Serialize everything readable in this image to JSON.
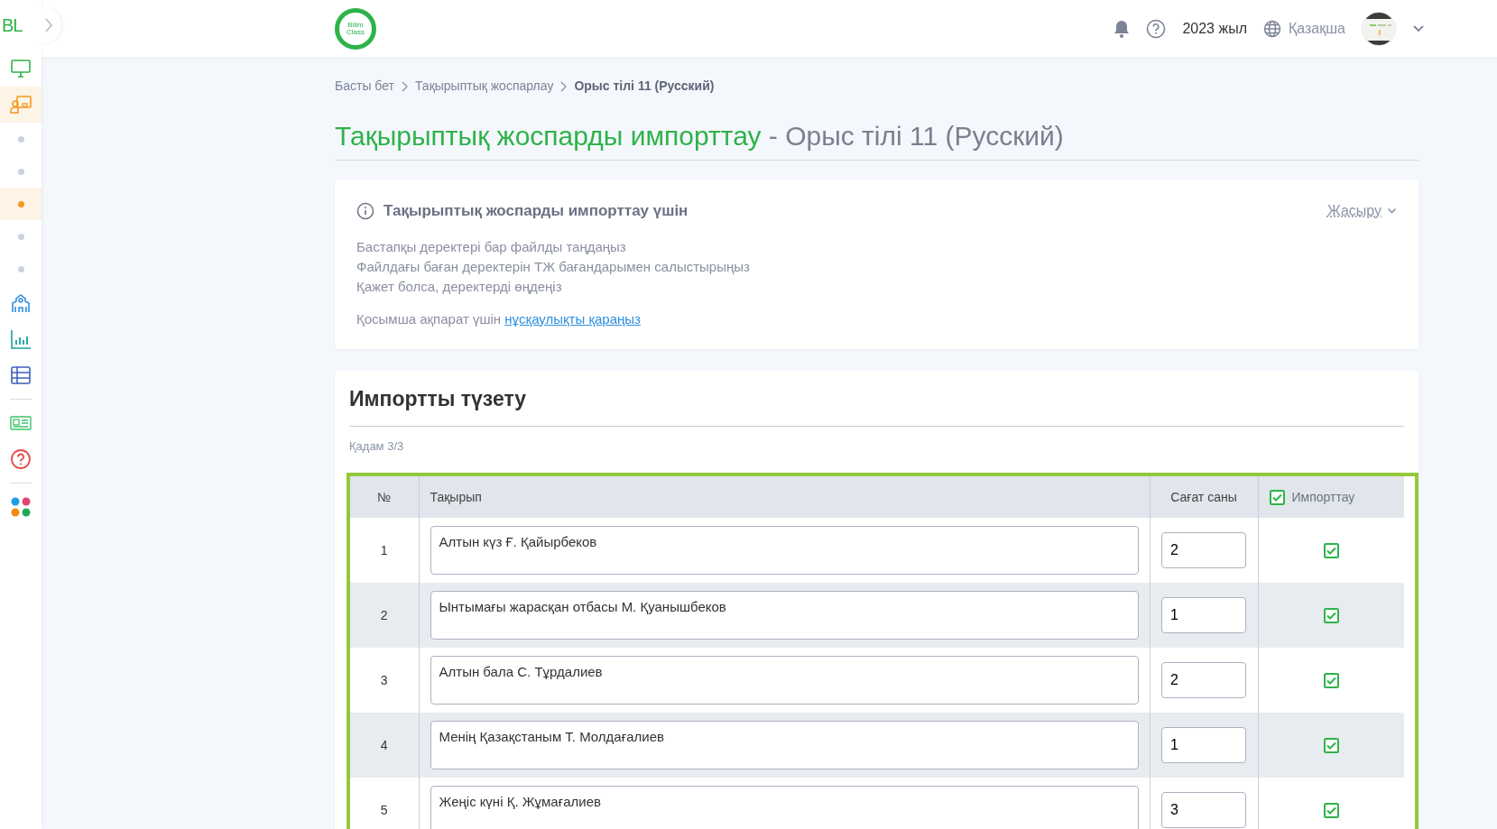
{
  "sidebar": {
    "logo": "BL",
    "items": [
      {
        "kind": "monitor",
        "selected": false
      },
      {
        "kind": "presentation",
        "selected": true
      },
      {
        "kind": "dot",
        "selected": false
      },
      {
        "kind": "dot",
        "selected": false
      },
      {
        "kind": "dot",
        "selected": true
      },
      {
        "kind": "dot",
        "selected": false
      },
      {
        "kind": "dot",
        "selected": false
      },
      {
        "kind": "school",
        "selected": false
      },
      {
        "kind": "chart",
        "selected": false
      },
      {
        "kind": "table",
        "selected": false
      },
      {
        "kind": "divider"
      },
      {
        "kind": "news",
        "selected": false
      },
      {
        "kind": "help",
        "selected": false
      },
      {
        "kind": "divider"
      },
      {
        "kind": "apps",
        "selected": false
      }
    ]
  },
  "header": {
    "logo_lines": [
      "Bilim",
      "Class"
    ],
    "year": "2023 жыл",
    "language": "Қазақша"
  },
  "breadcrumbs": [
    {
      "label": "Басты бет",
      "current": false
    },
    {
      "label": "Тақырыптық жоспарлау",
      "current": false
    },
    {
      "label": "Орыс тілі 11 (Русский)",
      "current": true
    }
  ],
  "title": {
    "main": "Тақырыптық жоспарды импорттау",
    "suffix": "- Орыс тілі 11 (Русский)"
  },
  "info": {
    "heading": "Тақырыптық жоспарды импорттау үшін",
    "toggle": "Жасыру",
    "steps": [
      "Бастапқы деректері бар файлды таңдаңыз",
      "Файлдағы баған деректерін ТЖ бағандарымен салыстырыңыз",
      "Қажет болса, деректерді өңдеңіз"
    ],
    "more_text": "Қосымша ақпарат үшін",
    "more_link": "нұсқаулықты қараңыз"
  },
  "editor": {
    "heading": "Импортты түзету",
    "step": "Қадам 3/3",
    "columns": {
      "number": "№",
      "topic": "Тақырып",
      "hours": "Сағат саны",
      "import": "Импорттау",
      "import_all_checked": true
    },
    "rows": [
      {
        "number": "1",
        "topic": "Алтын күз Ғ. Қайырбеков",
        "hours": "2",
        "checked": true
      },
      {
        "number": "2",
        "topic": "Ынтымағы жарасқан отбасы М. Қуанышбеков",
        "hours": "1",
        "checked": true
      },
      {
        "number": "3",
        "topic": "Алтын бала С. Тұрдалиев",
        "hours": "2",
        "checked": true
      },
      {
        "number": "4",
        "topic": "Менің Қазақстаным Т. Молдағалиев",
        "hours": "1",
        "checked": true
      },
      {
        "number": "5",
        "topic": "Жеңіс күні Қ. Жұмағалиев",
        "hours": "3",
        "checked": true
      }
    ]
  }
}
